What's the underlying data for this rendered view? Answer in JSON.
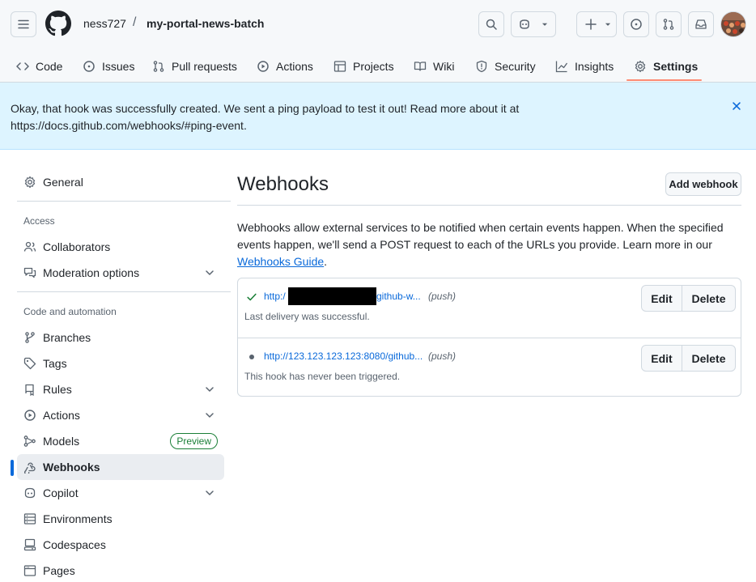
{
  "header": {
    "owner": "ness727",
    "separator": "/",
    "repo": "my-portal-news-batch"
  },
  "nav": {
    "tabs": [
      {
        "label": "Code",
        "icon": "code-icon"
      },
      {
        "label": "Issues",
        "icon": "issue-opened-icon"
      },
      {
        "label": "Pull requests",
        "icon": "git-pull-request-icon"
      },
      {
        "label": "Actions",
        "icon": "play-icon"
      },
      {
        "label": "Projects",
        "icon": "table-icon"
      },
      {
        "label": "Wiki",
        "icon": "book-icon"
      },
      {
        "label": "Security",
        "icon": "shield-icon"
      },
      {
        "label": "Insights",
        "icon": "graph-icon"
      },
      {
        "label": "Settings",
        "icon": "gear-icon",
        "active": true
      }
    ]
  },
  "flash": {
    "message": "Okay, that hook was successfully created. We sent a ping payload to test it out! Read more about it at https://docs.github.com/webhooks/#ping-event."
  },
  "sidebar": {
    "general": "General",
    "access_heading": "Access",
    "collaborators": "Collaborators",
    "moderation": "Moderation options",
    "code_heading": "Code and automation",
    "branches": "Branches",
    "tags": "Tags",
    "rules": "Rules",
    "actions": "Actions",
    "models": "Models",
    "models_badge": "Preview",
    "webhooks": "Webhooks",
    "copilot": "Copilot",
    "environments": "Environments",
    "codespaces": "Codespaces",
    "pages": "Pages"
  },
  "main": {
    "title": "Webhooks",
    "add_button": "Add webhook",
    "intro_text": "Webhooks allow external services to be notified when certain events happen. When the specified events happen, we'll send a POST request to each of the URLs you provide. Learn more in our ",
    "intro_link": "Webhooks Guide",
    "intro_end": ".",
    "hooks": [
      {
        "url_prefix": "http:/",
        "url_suffix": "github-w...",
        "events": "(push)",
        "status": "success",
        "message": "Last delivery was successful.",
        "edit": "Edit",
        "delete": "Delete"
      },
      {
        "url": "http://123.123.123.123:8080/github...",
        "events": "(push)",
        "status": "never",
        "message": "This hook has never been triggered.",
        "edit": "Edit",
        "delete": "Delete"
      }
    ]
  },
  "colors": {
    "accent": "#0969da",
    "success": "#1a7f37",
    "nav_underline": "#fd8c73",
    "flash_bg": "#ddf4ff"
  }
}
